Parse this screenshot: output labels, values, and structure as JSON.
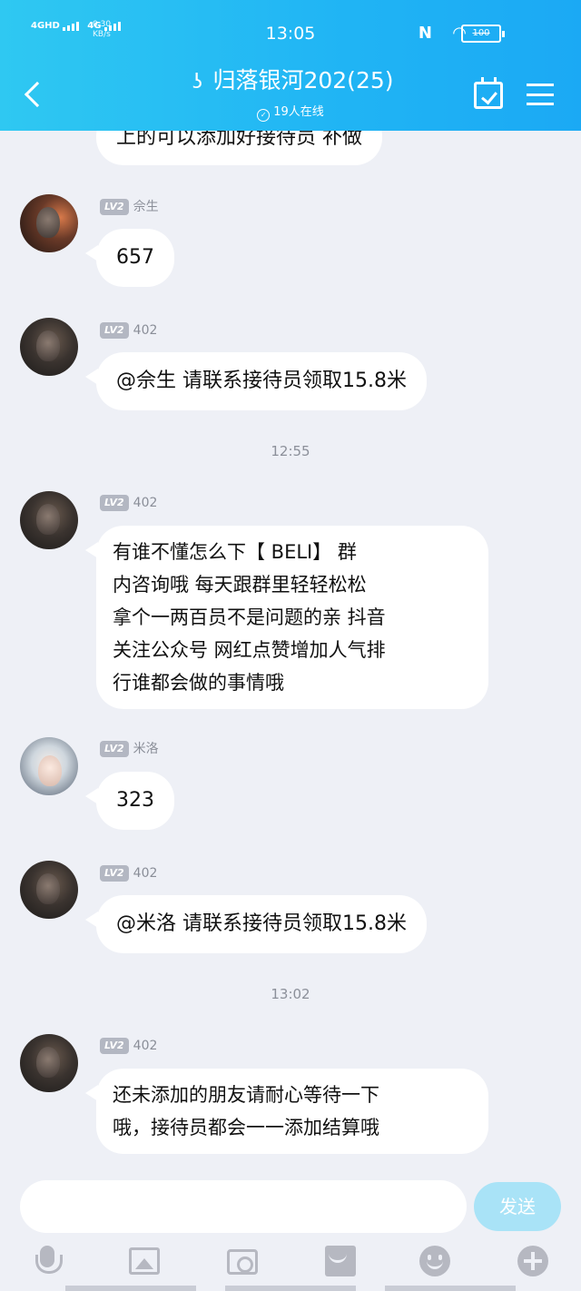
{
  "status": {
    "signal1": "4GHD",
    "signal2": "4G",
    "speed_value": "0.30",
    "speed_unit": "KB/s",
    "time": "13:05",
    "nfc": "N",
    "battery": "100"
  },
  "header": {
    "title": "归落银河202(25)",
    "online": "19人在线"
  },
  "messages": [
    {
      "text": "上的可以添加好接待员 补做"
    },
    {
      "level": "LV2",
      "sender": "佘生",
      "text": "657"
    },
    {
      "level": "LV2",
      "sender": "402",
      "text": "@佘生 请联系接待员领取15.8米"
    },
    {
      "time": "12:55"
    },
    {
      "level": "LV2",
      "sender": "402",
      "lines": [
        "有谁不懂怎么下【 BELI】    群",
        "内咨询哦  每天跟群里轻轻松松",
        "拿个一两百员不是问题的亲 抖音",
        "关注公众号 网红点赞增加人气排",
        "行谁都会做的事情哦"
      ]
    },
    {
      "level": "LV2",
      "sender": "米洛",
      "text": "323"
    },
    {
      "level": "LV2",
      "sender": "402",
      "text": "@米洛 请联系接待员领取15.8米"
    },
    {
      "time": "13:02"
    },
    {
      "level": "LV2",
      "sender": "402",
      "lines": [
        "还未添加的朋友请耐心等待一下",
        "哦，接待员都会一一添加结算哦"
      ]
    }
  ],
  "input": {
    "placeholder": "",
    "send_label": "发送"
  },
  "icons": [
    "back-icon",
    "ear-icon",
    "calendar-check-icon",
    "menu-icon",
    "mic-icon",
    "image-icon",
    "camera-icon",
    "red-packet-icon",
    "emoji-icon",
    "plus-icon"
  ]
}
